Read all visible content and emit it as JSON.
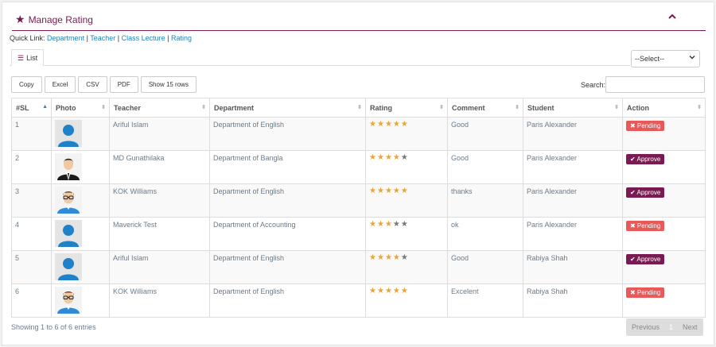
{
  "header": {
    "title": "Manage Rating",
    "collapse_icon": "chevron-up-icon",
    "title_icon": "star-icon"
  },
  "quick_links": {
    "label": "Quick Link:",
    "items": [
      "Department",
      "Teacher",
      "Class Lecture",
      "Rating"
    ],
    "separator": " | "
  },
  "tabs": [
    {
      "label": "List",
      "icon": "list-icon"
    }
  ],
  "filter_select": {
    "value": "--Select--"
  },
  "export_buttons": [
    "Copy",
    "Excel",
    "CSV",
    "PDF",
    "Show 15 rows"
  ],
  "search": {
    "label": "Search:",
    "value": ""
  },
  "table": {
    "headers": [
      "#SL",
      "Photo",
      "Teacher",
      "Department",
      "Rating",
      "Comment",
      "Student",
      "Action"
    ],
    "rows": [
      {
        "sl": "1",
        "photo": "placeholder",
        "teacher": "Ariful Islam",
        "department": "Department of English",
        "rating": 5,
        "comment": "Good",
        "student": "Paris Alexander",
        "action": "Pending"
      },
      {
        "sl": "2",
        "photo": "suit",
        "teacher": "MD Gunathilaka",
        "department": "Department of Bangla",
        "rating": 4,
        "comment": "Good",
        "student": "Paris Alexander",
        "action": "Approve"
      },
      {
        "sl": "3",
        "photo": "glasses",
        "teacher": "KOK Williams",
        "department": "Department of English",
        "rating": 5,
        "comment": "thanks",
        "student": "Paris Alexander",
        "action": "Approve"
      },
      {
        "sl": "4",
        "photo": "placeholder",
        "teacher": "Maverick Test",
        "department": "Department of Accounting",
        "rating": 3,
        "comment": "ok",
        "student": "Paris Alexander",
        "action": "Pending"
      },
      {
        "sl": "5",
        "photo": "placeholder",
        "teacher": "Ariful Islam",
        "department": "Department of English",
        "rating": 4,
        "comment": "Good",
        "student": "Rabiya Shah",
        "action": "Approve"
      },
      {
        "sl": "6",
        "photo": "glasses",
        "teacher": "KOK Williams",
        "department": "Department of English",
        "rating": 5,
        "comment": "Excelent",
        "student": "Rabiya Shah",
        "action": "Pending"
      }
    ],
    "max_rating": 5
  },
  "footer": {
    "info": "Showing 1 to 6 of 6 entries",
    "prev": "Previous",
    "page": "1",
    "next": "Next"
  },
  "colors": {
    "accent": "#7a1a52",
    "link": "#1f82c0",
    "star": "#f0a32c",
    "pending": "#e8595a",
    "approve": "#7a1a52"
  }
}
